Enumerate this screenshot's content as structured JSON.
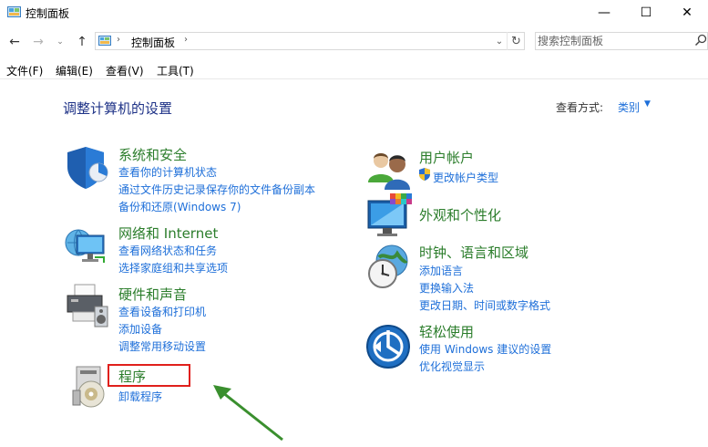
{
  "window": {
    "title": "控制面板",
    "minimize_symbol": "—",
    "maximize_symbol": "☐",
    "close_symbol": "✕"
  },
  "nav": {
    "back": "←",
    "forward": "→",
    "recent": "⌄",
    "up": "↑"
  },
  "address": {
    "path": "控制面板",
    "separator": "›",
    "dropdown": "⌄",
    "refresh": "↻"
  },
  "search": {
    "placeholder": "搜索控制面板"
  },
  "menu": {
    "file": "文件(F)",
    "edit": "编辑(E)",
    "view": "查看(V)",
    "tools": "工具(T)"
  },
  "content": {
    "title": "调整计算机的设置",
    "view_by_label": "查看方式:",
    "view_by_value": "类别",
    "view_by_caret": "▼"
  },
  "categories_left": [
    {
      "title": "系统和安全",
      "icon": "shield-icon",
      "links": [
        "查看你的计算机状态",
        "通过文件历史记录保存你的文件备份副本",
        "备份和还原(Windows 7)"
      ]
    },
    {
      "title": "网络和 Internet",
      "icon": "network-icon",
      "links": [
        "查看网络状态和任务",
        "选择家庭组和共享选项"
      ]
    },
    {
      "title": "硬件和声音",
      "icon": "printer-icon",
      "links": [
        "查看设备和打印机",
        "添加设备",
        "调整常用移动设置"
      ]
    },
    {
      "title": "程序",
      "icon": "programs-icon",
      "links": [
        "卸载程序"
      ]
    }
  ],
  "categories_right": [
    {
      "title": "用户帐户",
      "icon": "users-icon",
      "links": [
        "更改帐户类型"
      ]
    },
    {
      "title": "外观和个性化",
      "icon": "appearance-icon",
      "links": []
    },
    {
      "title": "时钟、语言和区域",
      "icon": "clock-globe-icon",
      "links": [
        "添加语言",
        "更换输入法",
        "更改日期、时间或数字格式"
      ]
    },
    {
      "title": "轻松使用",
      "icon": "ease-of-access-icon",
      "links": [
        "使用 Windows 建议的设置",
        "优化视觉显示"
      ]
    }
  ],
  "colors": {
    "category_title": "#2b7d2b",
    "link": "#1e6fd9",
    "heading": "#1e3287",
    "highlight": "#e0201c",
    "arrow": "#3a8f2e"
  }
}
